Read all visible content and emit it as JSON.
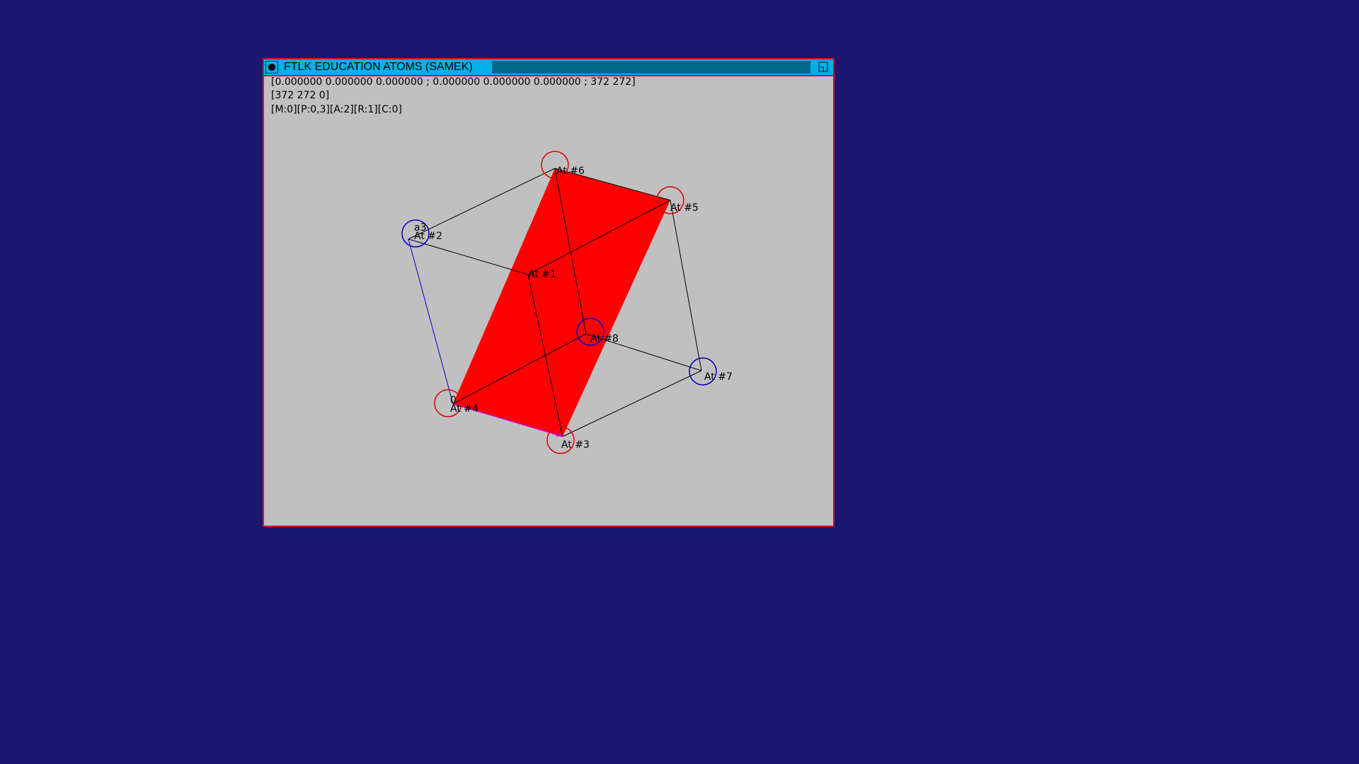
{
  "window": {
    "title": "FTLK EDUCATION ATOMS (SAMEK)",
    "menu_icon": "circle-dot-icon",
    "maximize_icon": "maximize-icon",
    "colors": {
      "border": "#d0102a",
      "titlebar": "#00b0e6",
      "title_fill": "#006a8c",
      "client_background": "#c0c0c0",
      "desktop_background": "#19176e"
    }
  },
  "info": {
    "line1": "[0.000000 0.000000 0.000000 ; 0.000000 0.000000 0.000000 ; 372 272]",
    "line2": "[372 272 0]",
    "line3": "[M:0][P:0,3][A:2][R:1][C:0]"
  },
  "scene": {
    "atoms": [
      {
        "id": "At #1",
        "label": "At #1"
      },
      {
        "id": "At #2",
        "label": "At #2",
        "color": "#0000cc",
        "extra_label": "a3"
      },
      {
        "id": "At #3",
        "label": "At #3",
        "color": "#dd0000"
      },
      {
        "id": "At #4",
        "label": "At #4",
        "color": "#dd0000",
        "extra_label": "0"
      },
      {
        "id": "At #5",
        "label": "At #5",
        "color": "#dd0000"
      },
      {
        "id": "At #6",
        "label": "At #6",
        "color": "#dd0000"
      },
      {
        "id": "At #7",
        "label": "At #7",
        "color": "#0000cc"
      },
      {
        "id": "At #8",
        "label": "At #8",
        "color": "#0000cc"
      }
    ],
    "plane_color": "#ff0000",
    "edge_color": "#000000",
    "axis_edge_color": "#0000cc",
    "highlight_edge_color": "#cc00cc"
  }
}
